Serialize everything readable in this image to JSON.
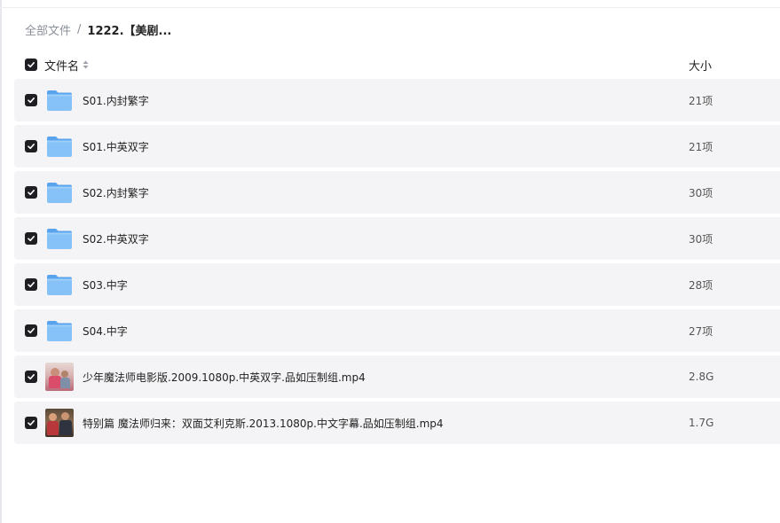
{
  "breadcrumb": {
    "root": "全部文件",
    "separator": "/",
    "current": "1222.【美剧..."
  },
  "header": {
    "name_label": "文件名",
    "size_label": "大小"
  },
  "files": [
    {
      "name": "S01.内封繁字",
      "size": "21项",
      "icon": "folder-icon"
    },
    {
      "name": "S01.中英双字",
      "size": "21项",
      "icon": "folder-icon"
    },
    {
      "name": "S02.内封繁字",
      "size": "30项",
      "icon": "folder-icon"
    },
    {
      "name": "S02.中英双字",
      "size": "30项",
      "icon": "folder-icon"
    },
    {
      "name": "S03.中字",
      "size": "28项",
      "icon": "folder-icon"
    },
    {
      "name": "S04.中字",
      "size": "27项",
      "icon": "folder-icon"
    },
    {
      "name": "少年魔法师电影版.2009.1080p.中英双字.品如压制组.mp4",
      "size": "2.8G",
      "icon": "video-thumbnail-icon"
    },
    {
      "name": "特别篇 魔法师归来：双面艾利克斯.2013.1080p.中文字幕.品如压制组.mp4",
      "size": "1.7G",
      "icon": "video-thumbnail-icon"
    }
  ],
  "colors": {
    "checkbox": "#1f1f23",
    "row_background": "#f4f4f6",
    "folder_blue": "#7ab8f5"
  }
}
